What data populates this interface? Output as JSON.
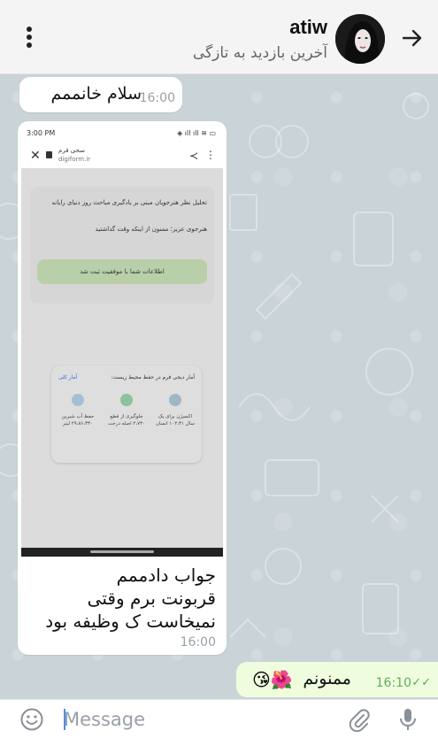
{
  "header": {
    "name": "atiw",
    "status": "آخرین بازدید به تازگی",
    "icons": {
      "menu": "vertical-dots-icon",
      "back": "arrow-right-icon"
    }
  },
  "messages": {
    "m1": {
      "text": "سلام خانممم",
      "time": "16:00"
    },
    "m2": {
      "caption_line1": "جواب دادممم",
      "caption_line2": "قربونت برم وقتی",
      "caption_line3": "نمیخاست ک وظیفه بود",
      "time": "16:00",
      "screenshot": {
        "status_time": "3:00 PM",
        "status_icons": "◈ ıll ıll ≋ ▭",
        "page_title": "سحی فرم",
        "page_url": "digiform.ir",
        "line1": "تحلیل نظر هنرجویان مبنی بر یادگیری مباحث روز دنیای رایانه",
        "line2": "هنرجوی عزیز؛ ممنون از اینکه وقت گذاشتید",
        "success": "اطلاعات شما با موفقیت ثبت شد",
        "stats_title": "آمار دیجی فرم در حفظ محیط زیست:",
        "stats_link": "آمار کلی",
        "stat1": "اکسیژن برای یک سال ۱۰۲،۳۱ انسان",
        "stat2": "جلوگیری از قطع ۴،۷۳۰ اصله درخت",
        "stat3": "حفظ آب شیرین ۲۹،۸۶،۳۳۰ لیتر"
      }
    },
    "m3": {
      "text": "ممنونم",
      "emoji": "😘🌺",
      "time": "16:10",
      "ticks": "✓✓"
    }
  },
  "input": {
    "placeholder": "Message"
  },
  "icons": {
    "emoji": "smiley-icon",
    "attach": "paperclip-icon",
    "mic": "microphone-icon"
  },
  "colors": {
    "outgoing_bubble": "#effdde",
    "incoming_bubble": "#ffffff",
    "wallpaper": "#c9d3d8",
    "accent": "#4caf50"
  }
}
